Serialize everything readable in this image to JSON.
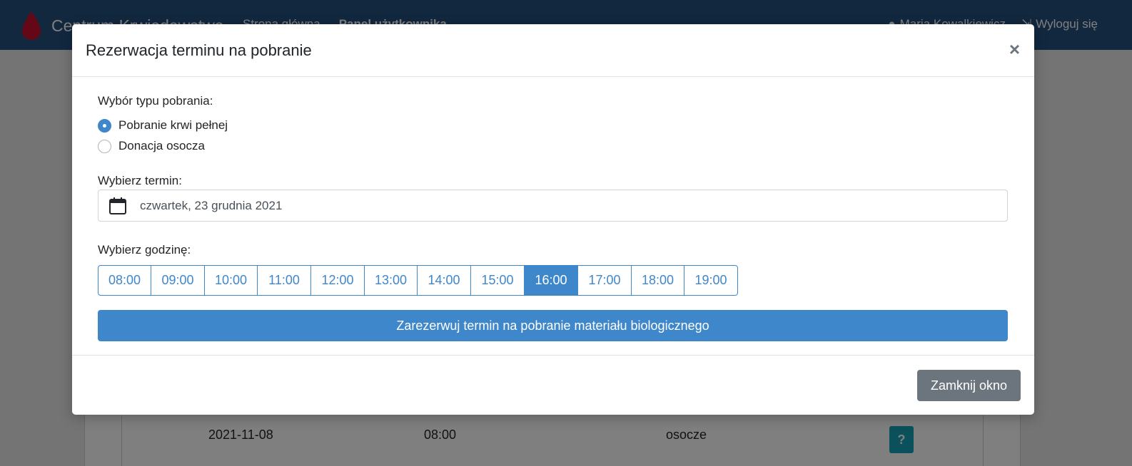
{
  "app": {
    "brand": "Centrum Krwiodawstwa",
    "nav": {
      "home": "Strona główna",
      "panel": "Panel użytkownika"
    },
    "user": "Maria Kowalkiewicz",
    "logout": "Wyloguj się"
  },
  "background_row": {
    "date": "2021-11-08",
    "time": "08:00",
    "type": "osocze",
    "help_label": "?"
  },
  "modal": {
    "title": "Rezerwacja terminu na pobranie",
    "close_symbol": "×",
    "type_label": "Wybór typu pobrania:",
    "options": [
      {
        "label": "Pobranie krwi pełnej",
        "selected": true
      },
      {
        "label": "Donacja osocza",
        "selected": false
      }
    ],
    "date_label": "Wybierz termin:",
    "date_value": "czwartek, 23 grudnia 2021",
    "hour_label": "Wybierz godzinę:",
    "hours": [
      "08:00",
      "09:00",
      "10:00",
      "11:00",
      "12:00",
      "13:00",
      "14:00",
      "15:00",
      "16:00",
      "17:00",
      "18:00",
      "19:00"
    ],
    "selected_hour": "16:00",
    "reserve_button": "Zarezerwuj termin na pobranie materiału biologicznego",
    "close_button": "Zamknij okno"
  },
  "colors": {
    "navbar": "#24517e",
    "primary": "#3f87cb",
    "secondary": "#6c757d",
    "info": "#17a2b8"
  }
}
